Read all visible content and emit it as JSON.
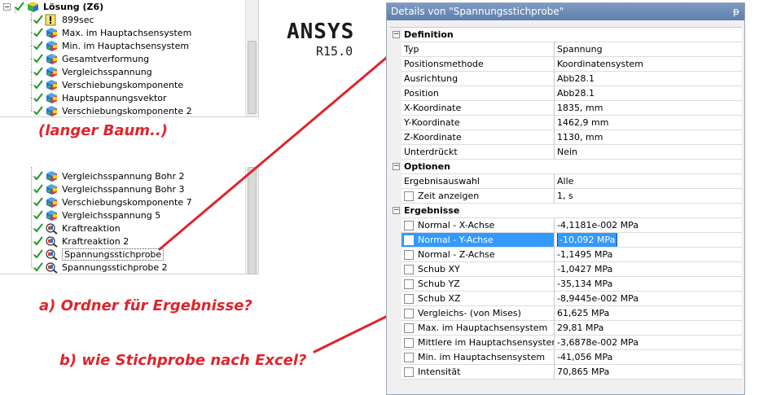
{
  "tree": {
    "top_items": [
      {
        "label": "Lösung (Z6)",
        "icon": "solution-icon",
        "root": true
      },
      {
        "label": "899sec",
        "icon": "warning-icon"
      },
      {
        "label": "Max. im Hauptachsensystem",
        "icon": "result-cube-icon"
      },
      {
        "label": "Min. im Hauptachsensystem",
        "icon": "result-cube-icon"
      },
      {
        "label": "Gesamtverformung",
        "icon": "result-cube-icon"
      },
      {
        "label": "Vergleichsspannung",
        "icon": "result-cube-icon"
      },
      {
        "label": "Verschiebungskomponente",
        "icon": "result-cube-icon"
      },
      {
        "label": "Hauptspannungsvektor",
        "icon": "result-cube-icon"
      },
      {
        "label": "Verschiebungskomponente 2",
        "icon": "result-cube-icon"
      }
    ],
    "bottom_items": [
      {
        "label": "Vergleichsspannung Bohr 2",
        "icon": "result-cube-icon"
      },
      {
        "label": "Vergleichsspannung Bohr 3",
        "icon": "result-cube-icon"
      },
      {
        "label": "Verschiebungskomponente 7",
        "icon": "result-cube-icon"
      },
      {
        "label": "Vergleichsspannung 5",
        "icon": "result-cube-icon"
      },
      {
        "label": "Kraftreaktion",
        "icon": "probe-icon"
      },
      {
        "label": "Kraftreaktion 2",
        "icon": "probe-icon"
      },
      {
        "label": "Spannungsstichprobe",
        "icon": "probe-icon",
        "selected": true
      },
      {
        "label": "Spannungsstichprobe 2",
        "icon": "probe-icon"
      }
    ]
  },
  "logo": {
    "name": "ANSYS",
    "version": "R15.0"
  },
  "annotations": {
    "long_tree": "(langer Baum..)",
    "question_a": "a) Ordner für Ergebnisse?",
    "question_b": "b) wie Stichprobe nach Excel?"
  },
  "details": {
    "title": "Details von \"Spannungsstichprobe\"",
    "pin_icon": "pin-icon",
    "sections": [
      {
        "label": "Definition",
        "expander": "−",
        "rows": [
          {
            "name": "Typ",
            "value": "Spannung"
          },
          {
            "name": "Positionsmethode",
            "value": "Koordinatensystem"
          },
          {
            "name": "Ausrichtung",
            "value": "Abb28.1"
          },
          {
            "name": "Position",
            "value": "Abb28.1"
          },
          {
            "name": "X-Koordinate",
            "value": "1835, mm"
          },
          {
            "name": "Y-Koordinate",
            "value": "1462,9 mm"
          },
          {
            "name": "Z-Koordinate",
            "value": "1130, mm"
          },
          {
            "name": "Unterdrückt",
            "value": "Nein"
          }
        ]
      },
      {
        "label": "Optionen",
        "expander": "−",
        "rows": [
          {
            "name": "Ergebnisauswahl",
            "value": "Alle"
          },
          {
            "name": "Zeit anzeigen",
            "value": "1, s",
            "checkbox": true
          }
        ]
      },
      {
        "label": "Ergebnisse",
        "expander": "−",
        "rows": [
          {
            "name": "Normal - X-Achse",
            "value": "-4,1181e-002 MPa",
            "checkbox": true
          },
          {
            "name": "Normal - Y-Achse",
            "value": "-10,092 MPa",
            "checkbox": true,
            "selected": true
          },
          {
            "name": "Normal - Z-Achse",
            "value": "-1,1495 MPa",
            "checkbox": true
          },
          {
            "name": "Schub XY",
            "value": "-1,0427 MPa",
            "checkbox": true
          },
          {
            "name": "Schub YZ",
            "value": "-35,134 MPa",
            "checkbox": true
          },
          {
            "name": "Schub XZ",
            "value": "-8,9445e-002 MPa",
            "checkbox": true
          },
          {
            "name": "Vergleichs- (von Mises)",
            "value": "61,625 MPa",
            "checkbox": true
          },
          {
            "name": "Max. im Hauptachsensystem",
            "value": "29,81 MPa",
            "checkbox": true
          },
          {
            "name": "Mittlere im Hauptachsensystem",
            "value": "-3,6878e-002 MPa",
            "checkbox": true
          },
          {
            "name": "Min. im Hauptachsensystem",
            "value": "-41,056 MPa",
            "checkbox": true
          },
          {
            "name": "Intensität",
            "value": "70,865 MPa",
            "checkbox": true
          }
        ]
      }
    ]
  },
  "colors": {
    "annotation_red": "#e0242b",
    "title_bar": "#6f8db8",
    "selection": "#3399ff"
  }
}
